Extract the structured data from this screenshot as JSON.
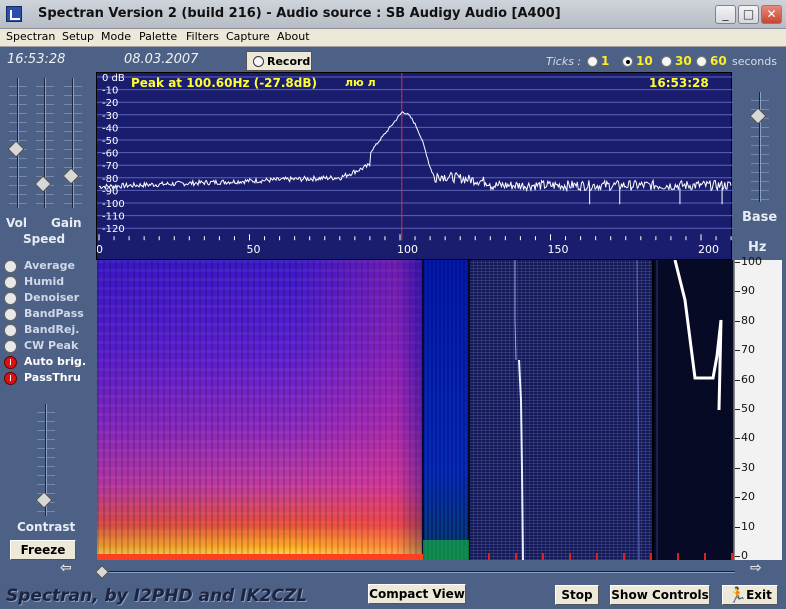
{
  "window": {
    "title": "Spectran Version 2 (build 216) - Audio source  :  SB Audigy Audio [A400]",
    "minimize_glyph": "_",
    "maximize_glyph": "□",
    "close_glyph": "✕"
  },
  "menu": [
    "Spectran",
    "Setup",
    "Mode",
    "Palette",
    "Filters",
    "Capture",
    "About"
  ],
  "info": {
    "time_left": "16:53:28",
    "date": "08.03.2007",
    "record_label": "Record"
  },
  "ticks": {
    "label": "Ticks :",
    "options": [
      "1",
      "10",
      "30",
      "60"
    ],
    "selected": "10",
    "unit": "seconds"
  },
  "sliders": {
    "vol_label": "Vol",
    "gain_label": "Gain",
    "speed_label": "Speed",
    "base_label": "Base",
    "contrast_label": "Contrast",
    "vol_level": 0.55,
    "gain_level": 0.85,
    "speed_level": 0.78,
    "base_level": 0.18,
    "contrast_level": 0.9
  },
  "options": [
    {
      "label": "Average",
      "on": false
    },
    {
      "label": "Humid",
      "on": false
    },
    {
      "label": "Denoiser",
      "on": false
    },
    {
      "label": "BandPass",
      "on": false
    },
    {
      "label": "BandRej.",
      "on": false
    },
    {
      "label": "CW Peak",
      "on": false
    },
    {
      "label": "Auto brig.",
      "on": true
    },
    {
      "label": "PassThru",
      "on": true
    }
  ],
  "buttons": {
    "freeze": "Freeze",
    "compact_view": "Compact View",
    "stop": "Stop",
    "show_controls": "Show Controls",
    "exit": "Exit"
  },
  "spectrum": {
    "peak_text": "Peak at   100.60Hz (-27.8dB)",
    "cyrillic_text": "лю л",
    "time_right": "16:53:28",
    "db_labels": [
      "0 dB",
      "-10",
      "-20",
      "-30",
      "-40",
      "-50",
      "-60",
      "-70",
      "-80",
      "-90",
      "-100",
      "-110",
      "-120"
    ],
    "freq_labels": [
      "0",
      "50",
      "100",
      "150",
      "200"
    ],
    "hz_unit": "Hz",
    "peak_frequency_hz": 100.6,
    "peak_db": -27.8,
    "colors": {
      "background": "#1a1d6e",
      "grid": "#5a63b8",
      "trace": "#ffffff",
      "marker": "#e03030",
      "text": "#ffff30"
    }
  },
  "waterfall": {
    "hz_labels": [
      "100",
      "90",
      "80",
      "70",
      "60",
      "50",
      "40",
      "30",
      "20",
      "10",
      "0"
    ]
  },
  "footer": {
    "credits": "Spectran, by I2PHD and IK2CZL"
  }
}
